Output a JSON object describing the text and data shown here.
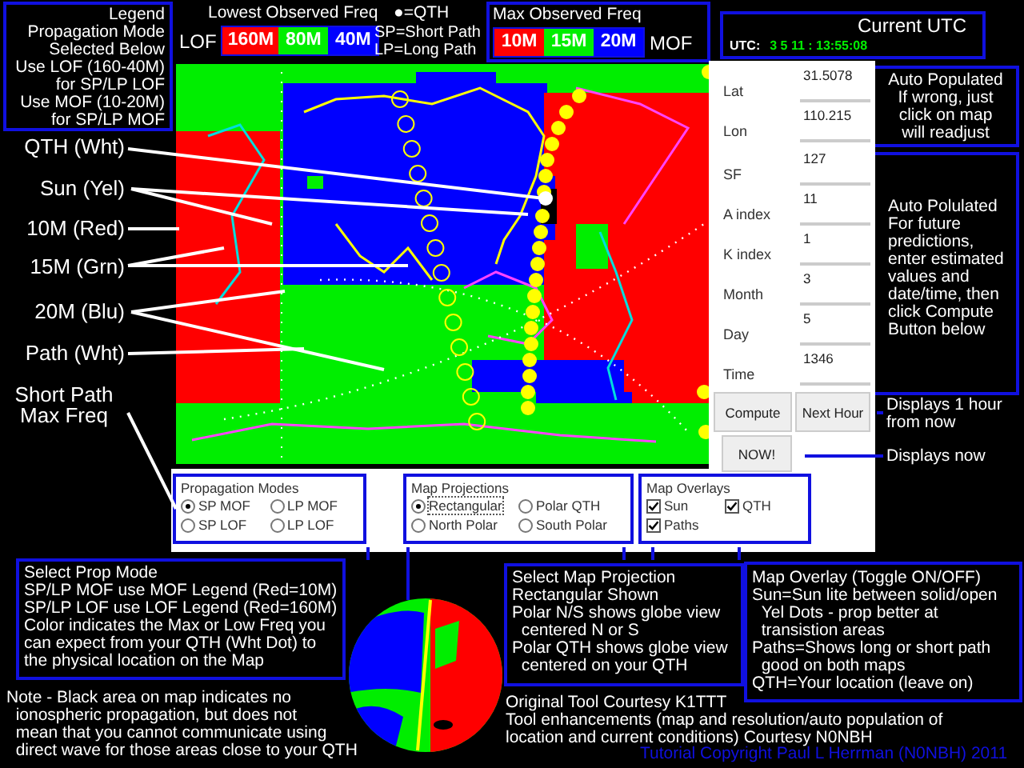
{
  "legend_note": {
    "lines": [
      "Legend",
      "Propagation Mode",
      "Selected Below",
      "Use LOF (160-40M)",
      "for SP/LP LOF",
      "Use MOF (10-20M)",
      "for SP/LP MOF"
    ]
  },
  "lof_legend": {
    "title": "Lowest Observed Freq",
    "label": "LOF",
    "bands": [
      {
        "label": "160M",
        "color": "#ff0000"
      },
      {
        "label": "80M",
        "color": "#00ee00"
      },
      {
        "label": "40M",
        "color": "#0000ff"
      }
    ]
  },
  "qth_key": "●=QTH",
  "path_key": [
    "SP=Short Path",
    "LP=Long Path"
  ],
  "mof_legend": {
    "title": "Max Observed Freq",
    "label": "MOF",
    "bands": [
      {
        "label": "10M",
        "color": "#ff0000"
      },
      {
        "label": "15M",
        "color": "#00ee00"
      },
      {
        "label": "20M",
        "color": "#0000ff"
      }
    ]
  },
  "utc": {
    "title": "Current UTC",
    "label": "UTC:",
    "value": "3 5 11 : 13:55:08"
  },
  "map_labels": [
    "QTH (Wht)",
    "Sun (Yel)",
    "10M (Red)",
    "15M (Grn)",
    "20M (Blu)",
    "Path (Wht)",
    "Short Path Max Freq"
  ],
  "location_fields": [
    {
      "label": "Lat",
      "value": "31.5078"
    },
    {
      "label": "Lon",
      "value": "110.215"
    }
  ],
  "condition_fields": [
    {
      "label": "SF",
      "value": "127"
    },
    {
      "label": "A index",
      "value": "11"
    },
    {
      "label": "K index",
      "value": "1"
    },
    {
      "label": "Month",
      "value": "3"
    },
    {
      "label": "Day",
      "value": "5"
    },
    {
      "label": "Time",
      "value": "1346"
    }
  ],
  "buttons": [
    {
      "kind": "compute",
      "label": "Compute"
    },
    {
      "kind": "next",
      "label": "Next Hour"
    },
    {
      "kind": "now",
      "label": "NOW!"
    }
  ],
  "right_notes": [
    {
      "kind": "location",
      "lines": [
        "Auto Populated",
        "If wrong, just",
        "click on map",
        "will readjust"
      ]
    },
    {
      "kind": "conditions",
      "lines": [
        "Auto Polulated",
        "For future",
        "predictions,",
        "enter estimated",
        "values and",
        "date/time, then",
        "click Compute",
        "Button below"
      ]
    },
    {
      "kind": "next",
      "lines": [
        "Displays 1 hour",
        "from now"
      ]
    },
    {
      "kind": "now",
      "lines": [
        "Displays now"
      ]
    }
  ],
  "propagation_modes": {
    "title": "Propagation Modes",
    "options": [
      {
        "label": "SP MOF",
        "selected": true
      },
      {
        "label": "LP MOF",
        "selected": false
      },
      {
        "label": "SP LOF",
        "selected": false
      },
      {
        "label": "LP LOF",
        "selected": false
      }
    ]
  },
  "map_projections": {
    "title": "Map Projections",
    "options": [
      {
        "label": "Rectangular",
        "selected": true
      },
      {
        "label": "Polar QTH",
        "selected": false
      },
      {
        "label": "North Polar",
        "selected": false
      },
      {
        "label": "South Polar",
        "selected": false
      }
    ]
  },
  "map_overlays": {
    "title": "Map Overlays",
    "options": [
      {
        "label": "Sun",
        "checked": true
      },
      {
        "label": "QTH",
        "checked": true
      },
      {
        "label": "Paths",
        "checked": true
      }
    ]
  },
  "bottom_notes": [
    {
      "kind": "prop",
      "lines": [
        "Select Prop Mode",
        "SP/LP MOF use MOF Legend (Red=10M)",
        "SP/LP LOF use LOF Legend (Red=160M)",
        "Color indicates the Max or Low Freq you",
        "can expect from your QTH (Wht Dot) to",
        "the physical location on the Map"
      ]
    },
    {
      "kind": "projection",
      "lines": [
        "Select Map Projection",
        "Rectangular Shown",
        "Polar N/S shows globe view",
        "  centered N or S",
        "Polar QTH shows globe view",
        "  centered on your QTH"
      ]
    },
    {
      "kind": "overlay",
      "lines": [
        "Map Overlay (Toggle ON/OFF)",
        "Sun=Sun lite between solid/open",
        "  Yel Dots - prop better at",
        "  transistion areas",
        "Paths=Shows long or short path",
        "  good on both maps",
        "QTH=Your location (leave on)"
      ]
    },
    {
      "kind": "note",
      "lines": [
        "Note - Black area on map indicates no",
        "  ionospheric propagation,   but does not",
        "  mean that you cannot communicate using",
        "  direct wave for those areas close to your QTH"
      ]
    },
    {
      "kind": "credits",
      "lines": [
        "Original Tool Courtesy K1TTT",
        "Tool enhancements (map and resolution/auto population of",
        "location and current conditions) Courtesy N0NBH"
      ]
    },
    {
      "kind": "copyright",
      "lines": [
        "Tutorial Copyright Paul L Herrman (N0NBH) 2011"
      ]
    }
  ]
}
